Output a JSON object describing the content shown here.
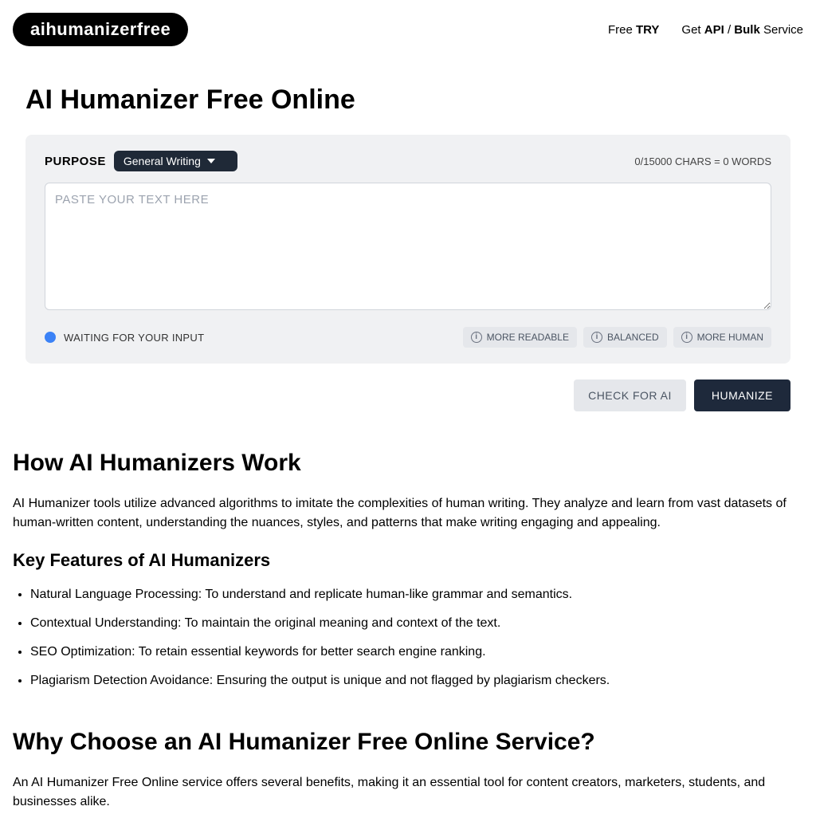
{
  "header": {
    "logo": "aihumanizerfree",
    "nav1_pre": "Free ",
    "nav1_bold": "TRY",
    "nav2_pre": "Get ",
    "nav2_bold1": "API",
    "nav2_mid": " / ",
    "nav2_bold2": "Bulk",
    "nav2_suf": " Service"
  },
  "title": "AI Humanizer Free Online",
  "panel": {
    "purpose_label": "PURPOSE",
    "purpose_value": "General Writing",
    "counter": "0/15000 CHARS = 0 WORDS",
    "placeholder": "PASTE YOUR TEXT HERE",
    "status": "WAITING FOR YOUR INPUT",
    "mode1": "MORE READABLE",
    "mode2": "BALANCED",
    "mode3": "MORE HUMAN"
  },
  "actions": {
    "check": "CHECK FOR AI",
    "humanize": "HUMANIZE"
  },
  "content": {
    "h2a": "How AI Humanizers Work",
    "p1": "AI Humanizer tools utilize advanced algorithms to imitate the complexities of human writing. They analyze and learn from vast datasets of human-written content, understanding the nuances, styles, and patterns that make writing engaging and appealing.",
    "h3a": "Key Features of AI Humanizers",
    "li1": "Natural Language Processing: To understand and replicate human-like grammar and semantics.",
    "li2": "Contextual Understanding: To maintain the original meaning and context of the text.",
    "li3": "SEO Optimization: To retain essential keywords for better search engine ranking.",
    "li4": "Plagiarism Detection Avoidance: Ensuring the output is unique and not flagged by plagiarism checkers.",
    "h2b": "Why Choose an AI Humanizer Free Online Service?",
    "p2": "An AI Humanizer Free Online service offers several benefits, making it an essential tool for content creators, marketers, students, and businesses alike."
  }
}
